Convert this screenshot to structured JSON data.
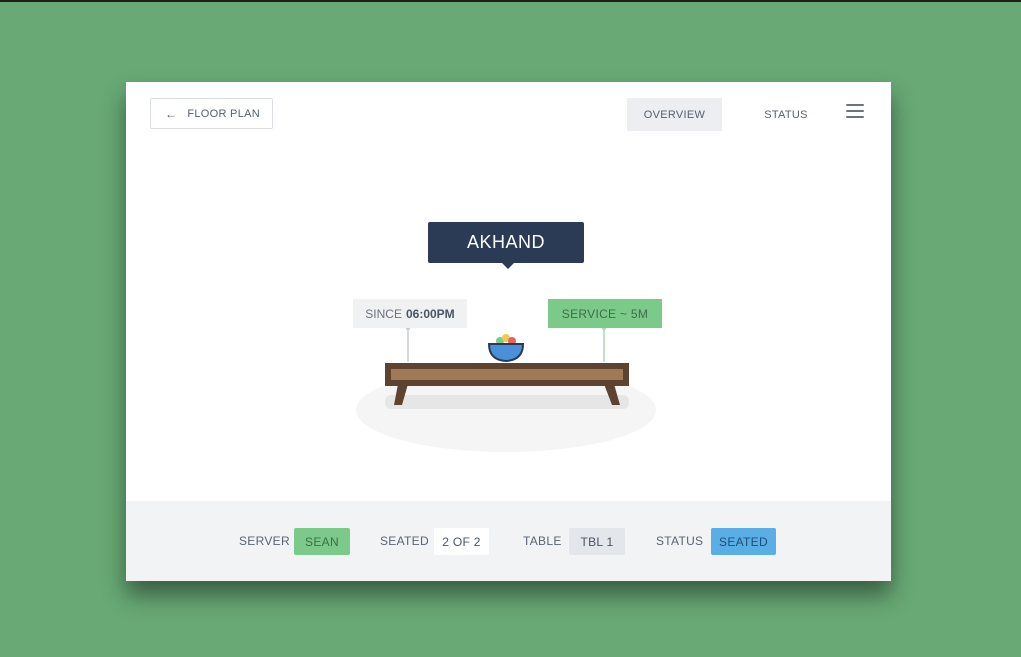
{
  "header": {
    "back_label": "FLOOR PLAN",
    "back_icon": "arrow-left-icon",
    "nav": {
      "overview": "OVERVIEW",
      "status": "STATUS"
    },
    "menu_icon": "hamburger-icon"
  },
  "table_view": {
    "guest_name": "AKHAND",
    "since_prefix": "SINCE",
    "since_time": "06:00PM",
    "service": "SERVICE ~ 5M"
  },
  "footer": {
    "server_label": "SERVER",
    "server_value": "SEAN",
    "seated_label": "SEATED",
    "seated_value": "2 OF 2",
    "table_label": "TABLE",
    "table_value": "TBL 1",
    "status_label": "STATUS",
    "status_value": "SEATED"
  },
  "colors": {
    "background": "#68a975",
    "navy": "#2b3b55",
    "green_pill": "#7cca8a",
    "blue_pill": "#5aaee6",
    "table_wood": "#5e4430"
  }
}
